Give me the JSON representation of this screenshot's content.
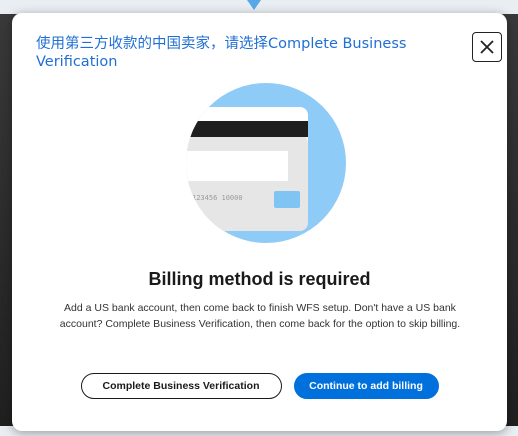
{
  "banner": {
    "note": "使用第三方收款的中国卖家，请选择Complete Business Verification"
  },
  "modal": {
    "close_icon": "close-icon",
    "card_number": "123456 10000",
    "title": "Billing method is required",
    "description": "Add a US bank account, then come back to finish WFS setup. Don't have a US bank account? Complete Business Verification, then come back for the option to skip billing.",
    "buttons": {
      "secondary": "Complete Business Verification",
      "primary": "Continue to add billing"
    }
  },
  "colors": {
    "accent": "#0071dc",
    "note_text": "#1f6fd4",
    "illustration_circle": "#8ecbf6"
  }
}
